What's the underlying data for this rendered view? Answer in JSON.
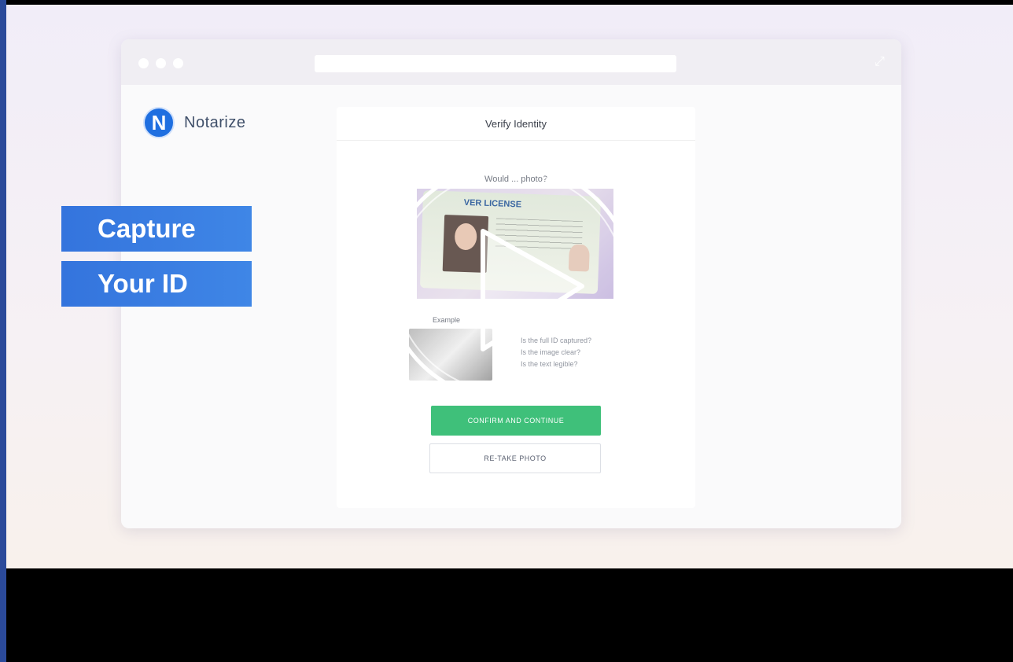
{
  "brand": {
    "name": "Notarize",
    "mark": "N"
  },
  "captions": [
    "Capture",
    "Your ID"
  ],
  "card": {
    "title": "Verify Identity",
    "question": "Would ... photo?",
    "license_title": "VER LICENSE",
    "example_label": "Example",
    "checklist": [
      "Is the full ID captured?",
      "Is the image clear?",
      "Is the text legible?"
    ],
    "confirm_label": "CONFIRM AND CONTINUE",
    "retake_label": "RE-TAKE PHOTO"
  },
  "colors": {
    "brand_blue": "#1f6fe0",
    "confirm_green": "#3fc07a",
    "caption_blue": "#3474dd",
    "frame_blue": "#2b4a9a"
  },
  "icons": {
    "play": "play-icon",
    "expand": "expand-icon"
  }
}
